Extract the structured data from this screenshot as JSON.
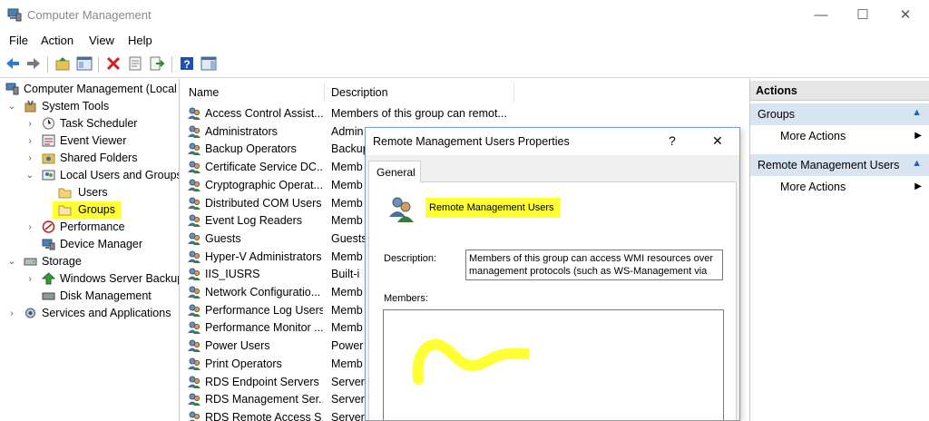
{
  "window": {
    "title": "Computer Management",
    "minimize": "—",
    "maximize": "☐",
    "close": "✕"
  },
  "menu": [
    "File",
    "Action",
    "View",
    "Help"
  ],
  "tree": [
    {
      "label": "Computer Management (Local",
      "expander": "",
      "icon": "computer-management-icon"
    },
    {
      "label": "System Tools",
      "expander": "⌄",
      "icon": "system-tools-icon"
    },
    {
      "label": "Task Scheduler",
      "expander": "›",
      "icon": "clock-icon"
    },
    {
      "label": "Event Viewer",
      "expander": "›",
      "icon": "event-viewer-icon"
    },
    {
      "label": "Shared Folders",
      "expander": "›",
      "icon": "shared-folder-icon"
    },
    {
      "label": "Local Users and Groups",
      "expander": "⌄",
      "icon": "users-groups-icon"
    },
    {
      "label": "Users",
      "expander": "",
      "icon": "folder-icon"
    },
    {
      "label": "Groups",
      "expander": "",
      "icon": "folder-icon"
    },
    {
      "label": "Performance",
      "expander": "›",
      "icon": "performance-icon"
    },
    {
      "label": "Device Manager",
      "expander": "",
      "icon": "device-manager-icon"
    },
    {
      "label": "Storage",
      "expander": "⌄",
      "icon": "storage-icon"
    },
    {
      "label": "Windows Server Backup",
      "expander": "›",
      "icon": "backup-icon"
    },
    {
      "label": "Disk Management",
      "expander": "",
      "icon": "disk-icon"
    },
    {
      "label": "Services and Applications",
      "expander": "›",
      "icon": "services-icon"
    }
  ],
  "list": {
    "columns": [
      "Name",
      "Description"
    ],
    "rows": [
      {
        "name": "Access Control Assist...",
        "desc": "Members of this group can remot..."
      },
      {
        "name": "Administrators",
        "desc": "Admin"
      },
      {
        "name": "Backup Operators",
        "desc": "Backup"
      },
      {
        "name": "Certificate Service DC...",
        "desc": "Memb"
      },
      {
        "name": "Cryptographic Operat...",
        "desc": "Memb"
      },
      {
        "name": "Distributed COM Users",
        "desc": "Memb"
      },
      {
        "name": "Event Log Readers",
        "desc": "Memb"
      },
      {
        "name": "Guests",
        "desc": "Guests"
      },
      {
        "name": "Hyper-V Administrators",
        "desc": "Memb"
      },
      {
        "name": "IIS_IUSRS",
        "desc": "Built-i"
      },
      {
        "name": "Network Configuratio...",
        "desc": "Memb"
      },
      {
        "name": "Performance Log Users",
        "desc": "Memb"
      },
      {
        "name": "Performance Monitor ...",
        "desc": "Memb"
      },
      {
        "name": "Power Users",
        "desc": "Power"
      },
      {
        "name": "Print Operators",
        "desc": "Memb"
      },
      {
        "name": "RDS Endpoint Servers",
        "desc": "Servers"
      },
      {
        "name": "RDS Management Ser...",
        "desc": "Servers"
      },
      {
        "name": "RDS Remote Access S...",
        "desc": "Servers"
      }
    ]
  },
  "actions": {
    "header": "Actions",
    "sections": [
      {
        "title": "Groups",
        "items": [
          "More Actions"
        ]
      },
      {
        "title": "Remote Management Users",
        "items": [
          "More Actions"
        ]
      }
    ],
    "collapse_glyph": "▲",
    "submenu_glyph": "▶"
  },
  "dialog": {
    "title": "Remote Management Users Properties",
    "help": "?",
    "close": "✕",
    "tab": "General",
    "group_name": "Remote Management Users",
    "description_label": "Description:",
    "description_value": "Members of this group can access WMI resources over management protocols (such as WS-Management via",
    "members_label": "Members:"
  },
  "colors": {
    "highlight": "#ffff33",
    "accent": "#2a64ad",
    "actions_header": "#e6e6e6",
    "section_bg": "#d9e4f1"
  }
}
